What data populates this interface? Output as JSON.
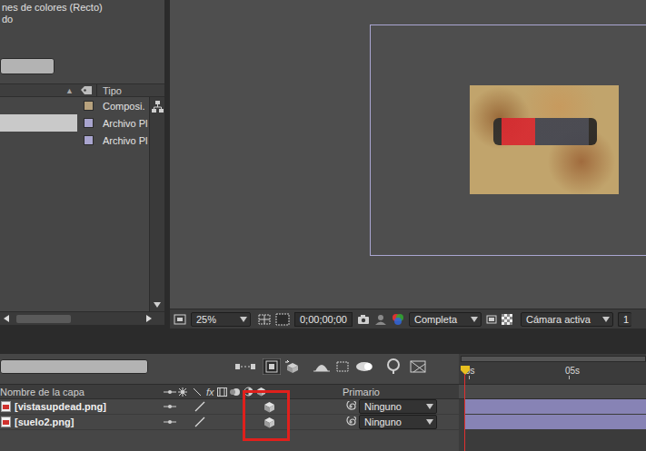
{
  "project": {
    "header_lines": [
      "nes de colores (Recto)",
      "do"
    ],
    "sort_indicator": "▲",
    "columns": [
      {
        "label": "Tipo"
      }
    ],
    "items": [
      {
        "type": "Composi.",
        "color": "#b7a27e",
        "selected": false
      },
      {
        "type": "Archivo Pl",
        "color": "#a9a5cf",
        "selected": true
      },
      {
        "type": "Archivo Pl",
        "color": "#a9a5cf",
        "selected": false
      }
    ]
  },
  "viewer": {
    "zoom": "25%",
    "timecode": "0;00;00;00",
    "resolution": "Completa",
    "camera": "Cámara activa",
    "views": "1"
  },
  "timeline": {
    "ruler": [
      "0s",
      "05s"
    ],
    "columns": {
      "name": "Nombre de la capa",
      "fx": "fx",
      "parent": "Primario"
    },
    "layers": [
      {
        "name": "[vistasupdead.png]",
        "parent": "Ninguno",
        "three_d": true
      },
      {
        "name": "[suelo2.png]",
        "parent": "Ninguno",
        "three_d": true
      }
    ]
  }
}
